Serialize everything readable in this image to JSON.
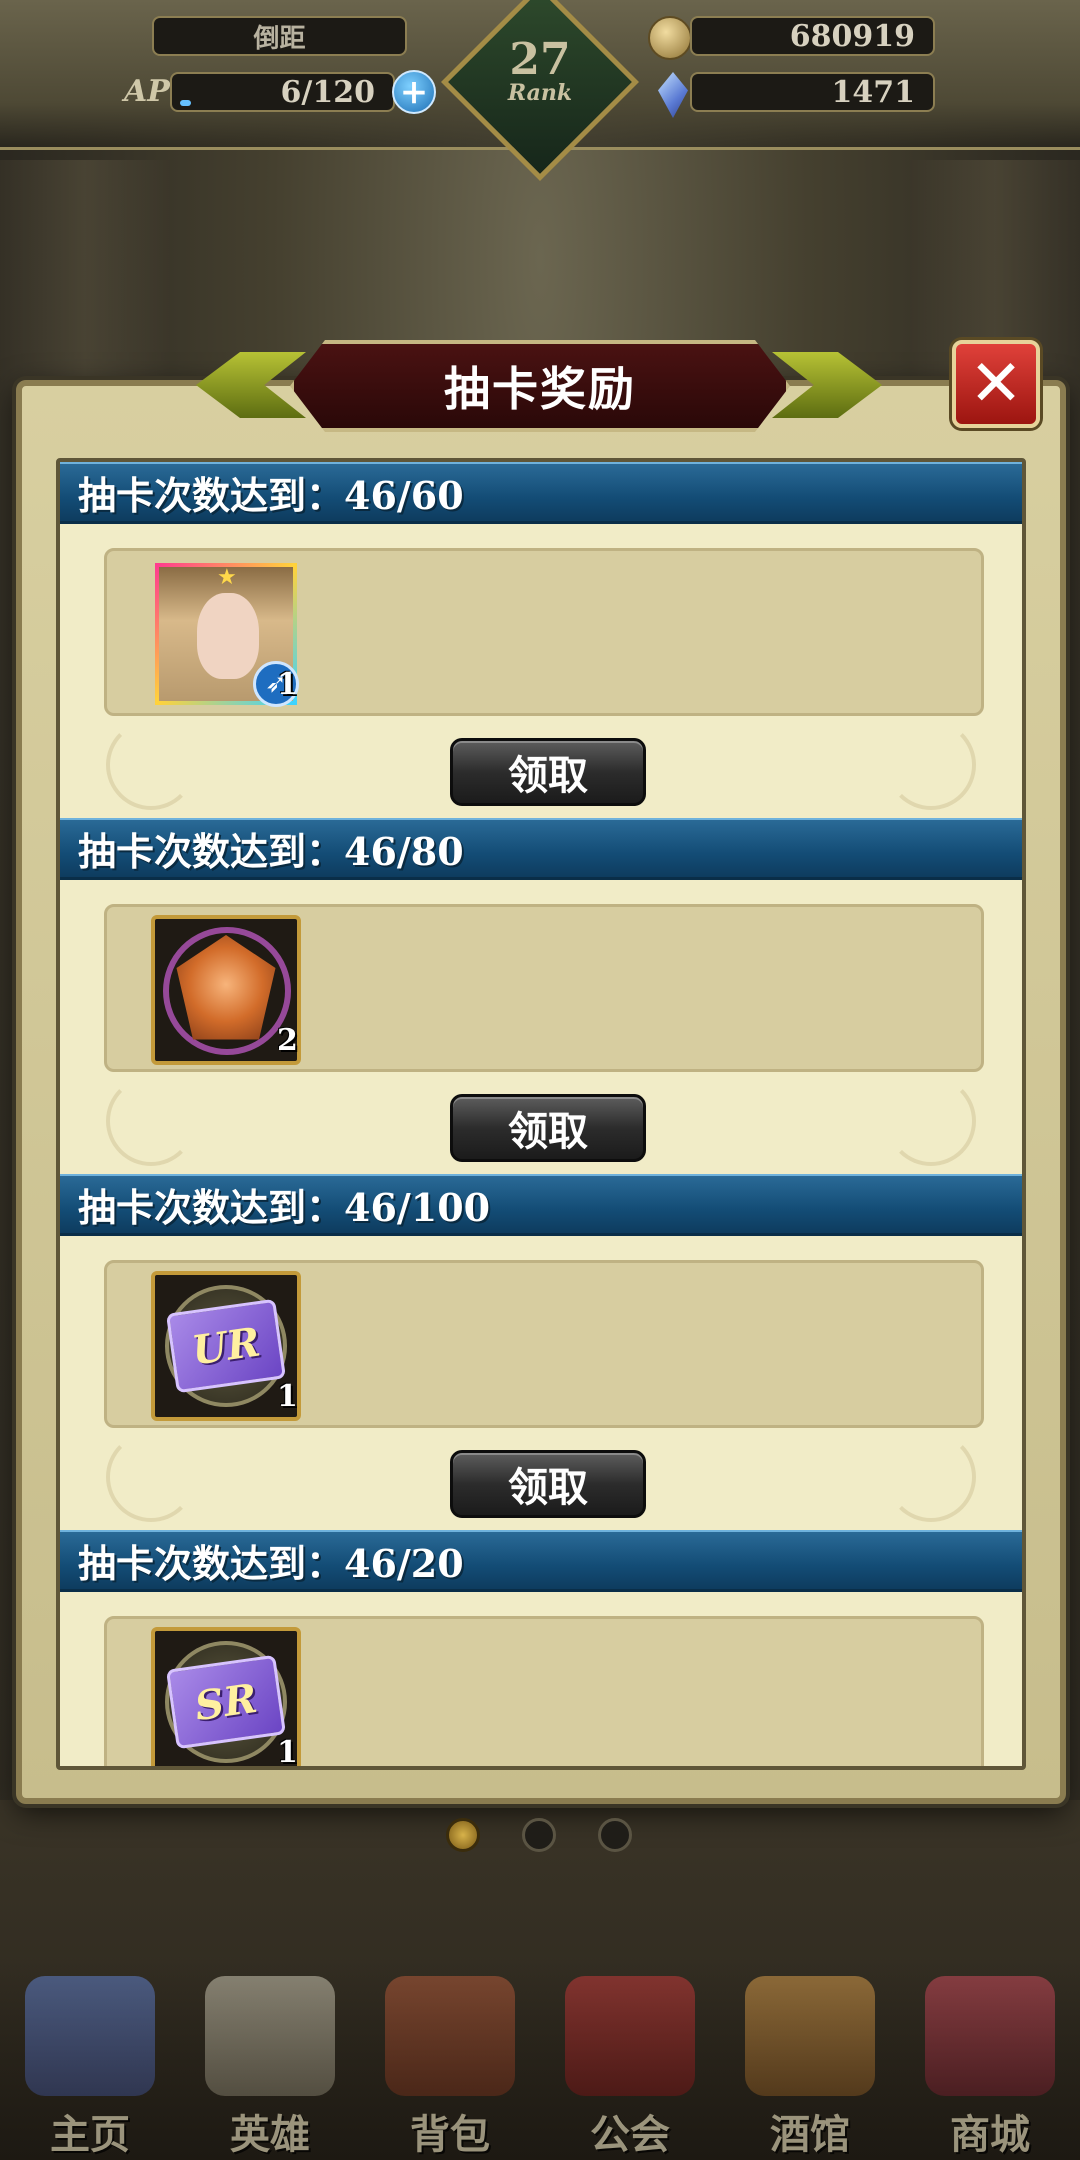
{
  "hud": {
    "player_name": "倒距",
    "ap_label": "AP",
    "ap_value": "6/120",
    "ap_fraction": 0.05,
    "rank_number": "27",
    "rank_label": "Rank",
    "gold": "680919",
    "gems": "1471"
  },
  "popup": {
    "title": "抽卡奖励",
    "close_symbol": "✕",
    "sections": [
      {
        "header": "抽卡次数达到：46/60",
        "item_icon": "hero-portrait-icon",
        "item_count": "1",
        "claim_label": "领取"
      },
      {
        "header": "抽卡次数达到：46/80",
        "item_icon": "gem-badge-icon",
        "item_count": "2",
        "claim_label": "领取"
      },
      {
        "header": "抽卡次数达到：46/100",
        "item_icon": "ur-ticket-icon",
        "item_card_text": "UR",
        "item_count": "1",
        "claim_label": "领取"
      },
      {
        "header": "抽卡次数达到：46/20",
        "item_icon": "sr-ticket-icon",
        "item_card_text": "SR",
        "item_count": "1"
      }
    ]
  },
  "pager": {
    "pages": 3,
    "active": 0
  },
  "bottom_nav": [
    {
      "label": "主页",
      "icon": "castle-icon"
    },
    {
      "label": "英雄",
      "icon": "helmet-icon"
    },
    {
      "label": "背包",
      "icon": "bag-icon"
    },
    {
      "label": "公会",
      "icon": "shield-icon"
    },
    {
      "label": "酒馆",
      "icon": "tavern-icon"
    },
    {
      "label": "商城",
      "icon": "shop-icon"
    }
  ],
  "colors": {
    "header_blue": "#134c75",
    "title_red": "#4a1212",
    "close_red": "#c62e28",
    "panel_cream": "#f1ecc7"
  }
}
